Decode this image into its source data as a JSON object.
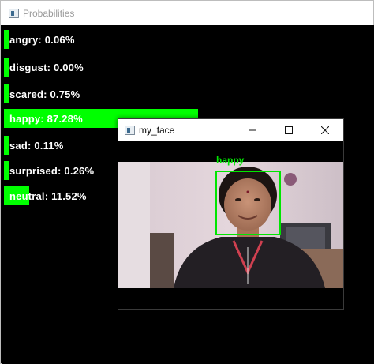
{
  "probabilities_window": {
    "title": "Probabilities",
    "icon": "opencv-window-icon",
    "rows": [
      {
        "label": "angry: 0.06%",
        "value": 0.0006
      },
      {
        "label": "disgust: 0.00%",
        "value": 0.0
      },
      {
        "label": "scared: 0.75%",
        "value": 0.0075
      },
      {
        "label": "happy: 87.28%",
        "value": 0.8728
      },
      {
        "label": "sad: 0.11%",
        "value": 0.0011
      },
      {
        "label": "surprised: 0.26%",
        "value": 0.0026
      },
      {
        "label": "neutral: 11.52%",
        "value": 0.1152
      }
    ],
    "bar_color": "#00ff00"
  },
  "face_window": {
    "title": "my_face",
    "icon": "opencv-window-icon",
    "controls": {
      "minimize": "—",
      "maximize": "☐",
      "close": "✕"
    },
    "detection_label": "happy",
    "box_color": "#00e600"
  }
}
